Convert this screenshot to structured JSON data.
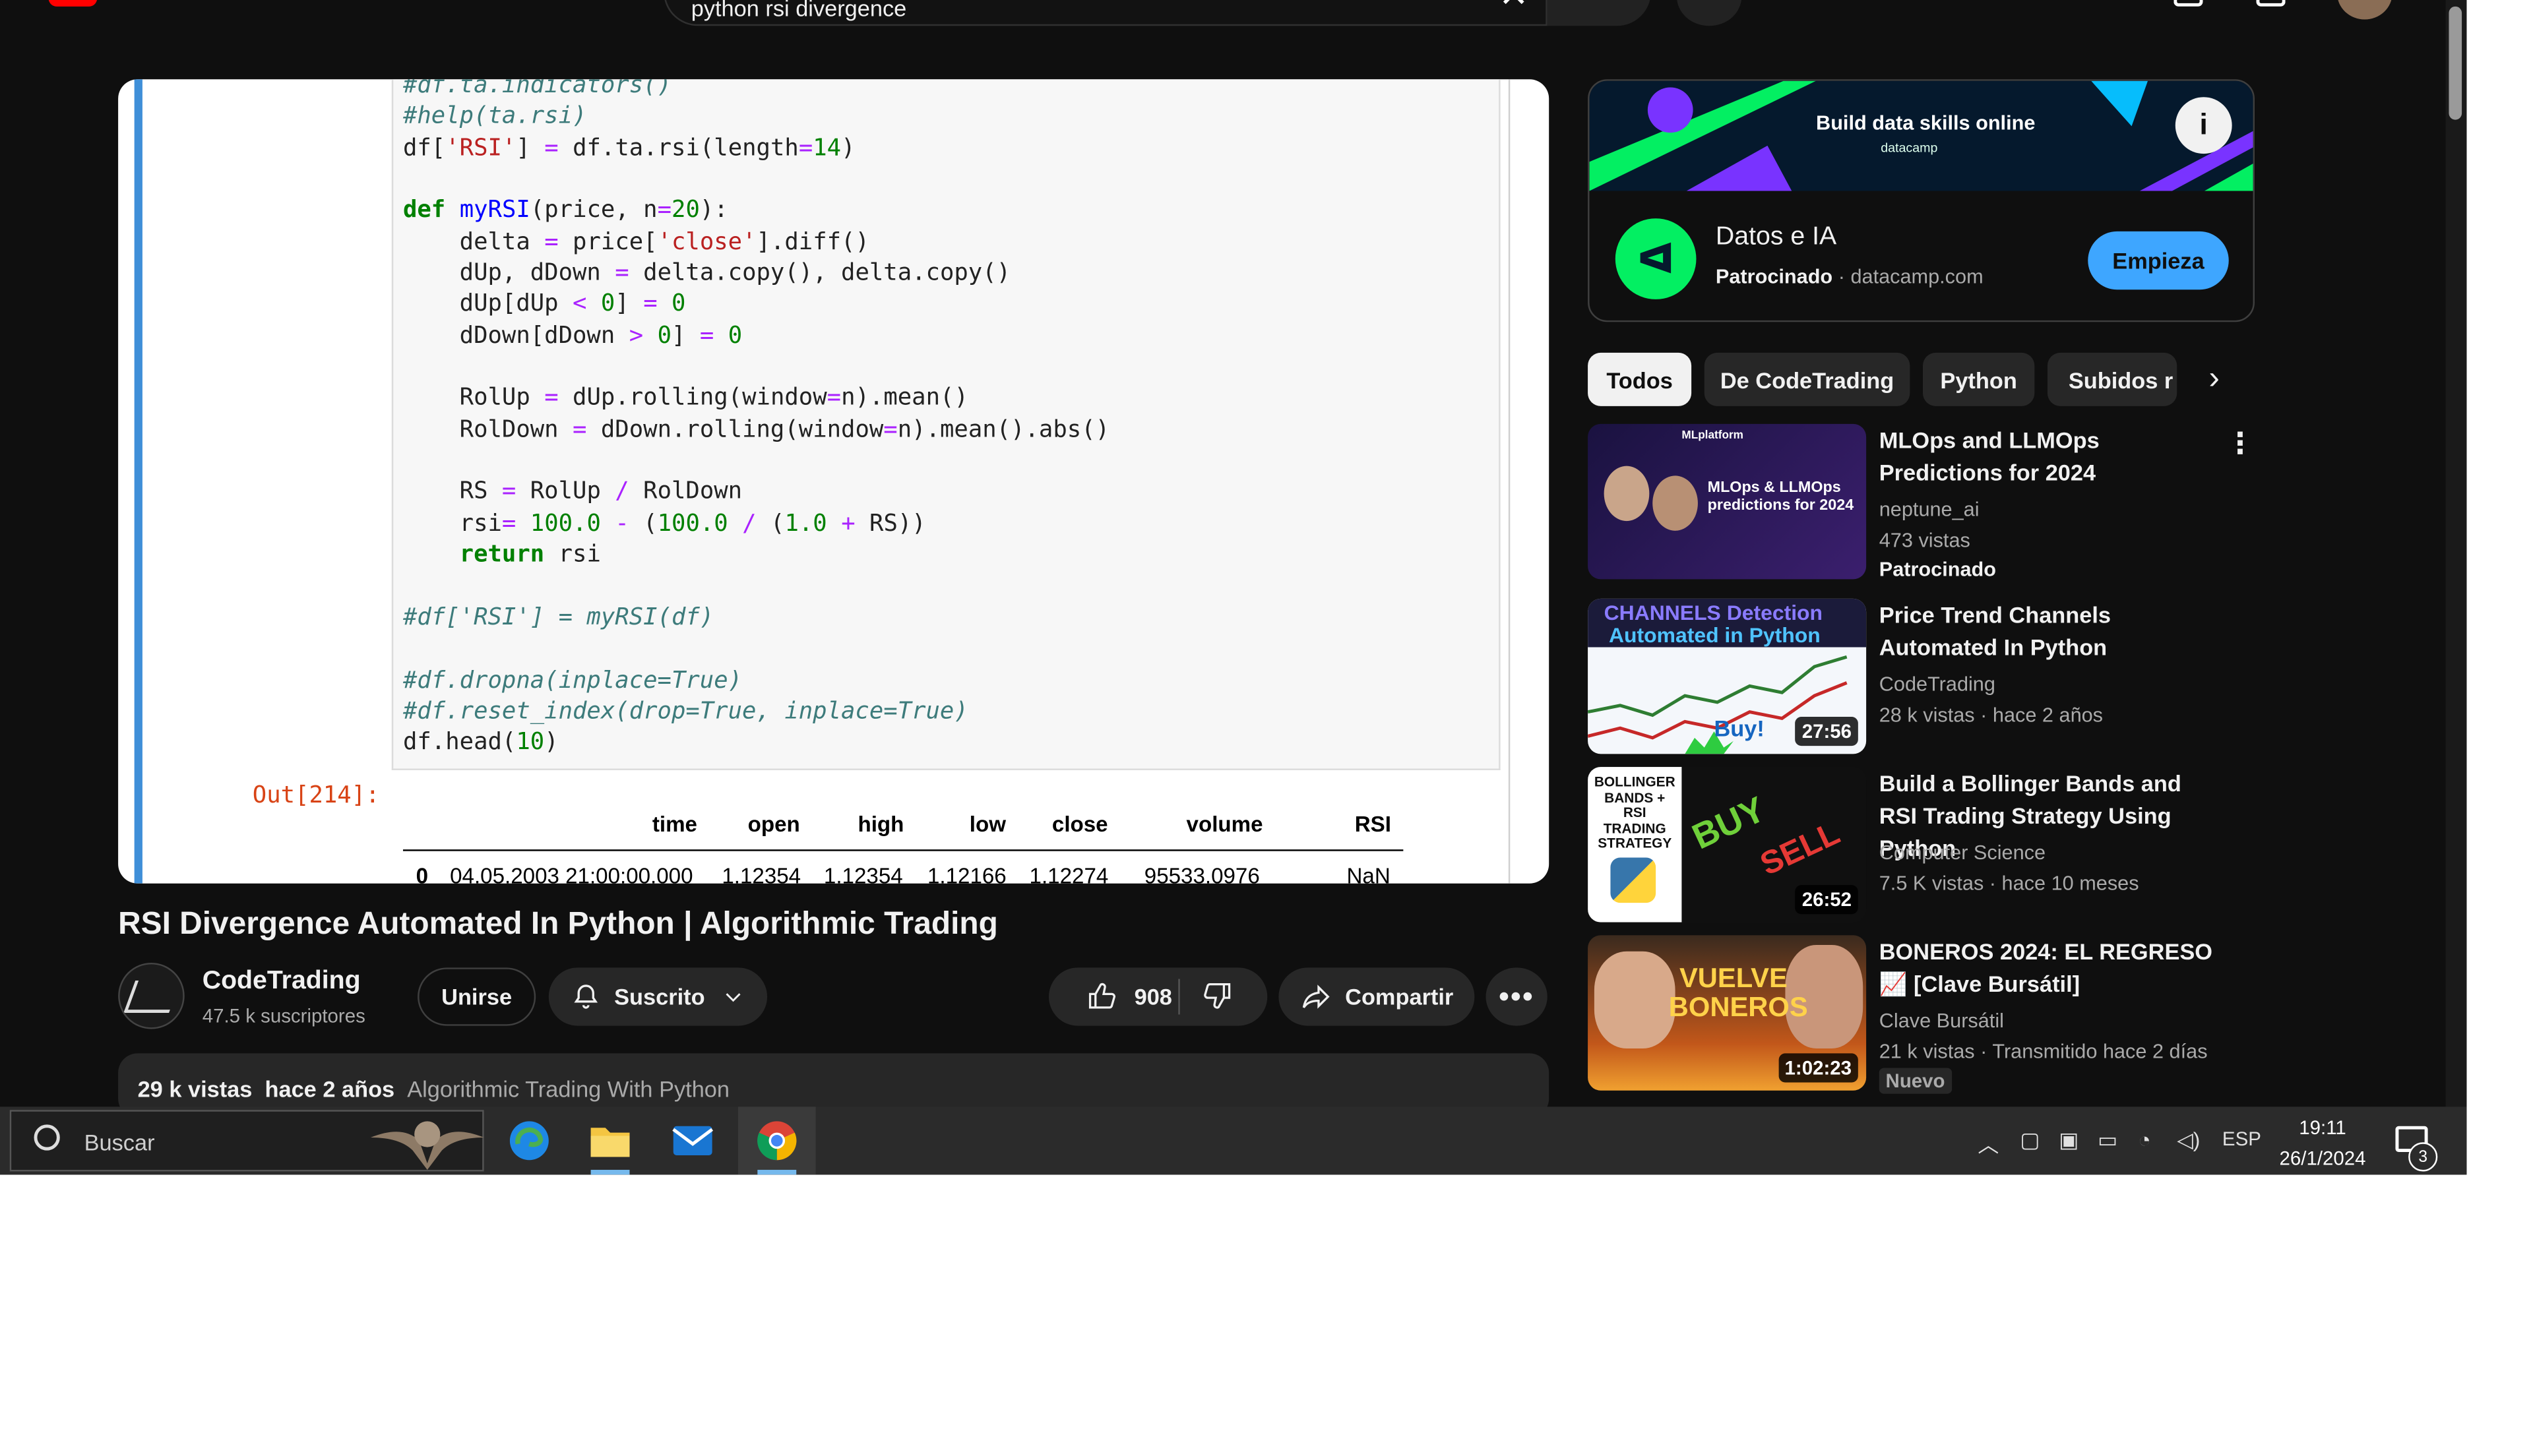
{
  "search": {
    "query": "python rsi divergence"
  },
  "video": {
    "title": "RSI Divergence Automated In Python | Algorithmic Trading",
    "output_label": "Out[214]:",
    "table": {
      "headers": [
        "time",
        "open",
        "high",
        "low",
        "close",
        "volume",
        "RSI"
      ],
      "row": [
        "0",
        "04.05.2003 21:00:00.000",
        "1.12354",
        "1.12354",
        "1.12166",
        "1.12274",
        "95533.0976",
        "NaN"
      ]
    }
  },
  "channel": {
    "name": "CodeTrading",
    "subscribers": "47.5 k suscriptores",
    "join_label": "Unirse",
    "subscribed_label": "Suscrito"
  },
  "actions": {
    "likes": "908",
    "share_label": "Compartir"
  },
  "description": {
    "views": "29 k vistas",
    "age": "hace 2 años",
    "tag": "Algorithmic Trading With Python"
  },
  "ad": {
    "banner_title": "Build data skills online",
    "banner_brand": "datacamp",
    "name": "Datos e IA",
    "sponsored_label": "Patrocinado",
    "domain": "datacamp.com",
    "cta": "Empieza"
  },
  "chips": [
    "Todos",
    "De CodeTrading",
    "Python",
    "Subidos r"
  ],
  "recommendations": [
    {
      "title": "MLOps and LLMOps Predictions for 2024",
      "channel": "neptune_ai",
      "meta": "473 vistas",
      "badge": "Patrocinado",
      "thumb_text": "MLOps & LLMOps predictions for 2024",
      "thumb_brand": "MLplatform"
    },
    {
      "title": "Price Trend Channels Automated In Python",
      "channel": "CodeTrading",
      "meta": "28 k vistas · hace 2 años",
      "duration": "27:56",
      "thumb_line1": "CHANNELS Detection",
      "thumb_line2": "Automated in Python",
      "thumb_buy": "Buy!"
    },
    {
      "title": "Build a Bollinger Bands and RSI Trading Strategy Using Python",
      "channel": "Computer Science",
      "meta": "7.5 K vistas · hace 10 meses",
      "duration": "26:52",
      "thumb_text": "BOLLINGER BANDS + RSI TRADING STRATEGY",
      "thumb_buy": "BUY",
      "thumb_sell": "SELL"
    },
    {
      "title": "BONEROS 2024: EL REGRESO 📈 [Clave Bursátil]",
      "channel": "Clave Bursátil",
      "meta": "21 k vistas · Transmitido hace 2 días",
      "badge": "Nuevo",
      "duration": "1:02:23",
      "thumb_text": "VUELVE BONEROS"
    }
  ],
  "taskbar": {
    "search_placeholder": "Buscar",
    "lang": "ESP",
    "time": "19:11",
    "date": "26/1/2024",
    "notifications": "3"
  },
  "colors": {
    "accent": "#3ea6ff",
    "background": "#0f0f0f",
    "datacamp_green": "#03ef62"
  }
}
